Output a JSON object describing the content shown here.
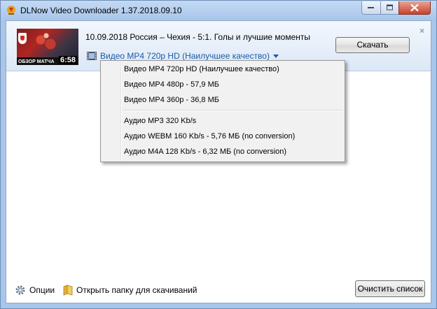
{
  "window": {
    "title": "DLNow Video Downloader 1.37.2018.09.10",
    "controls": {
      "minimize": "minimize",
      "maximize": "maximize",
      "close": "close"
    }
  },
  "item": {
    "thumbnail": {
      "caption": "ОБЗОР МАТЧА",
      "duration": "6:58"
    },
    "title": "10.09.2018 Россия – Чехия - 5:1. Голы и лучшие моменты",
    "selected_format": "Видео MP4 720p HD (Наилучшее качество)",
    "download_label": "Скачать",
    "close_glyph": "×"
  },
  "format_menu": {
    "video_options": [
      "Видео MP4 720p HD (Наилучшее качество)",
      "Видео MP4 480p - 57,9 МБ",
      "Видео MP4 360p - 36,8 МБ"
    ],
    "audio_options": [
      "Аудио MP3 320 Kb/s",
      "Аудио WEBM 160 Kb/s - 5,76 МБ (no conversion)",
      "Аудио M4A 128 Kb/s - 6,32 МБ (no conversion)"
    ]
  },
  "footer": {
    "options_label": "Опции",
    "open_folder_label": "Открыть папку для скачиваний",
    "clear_list_label": "Очистить список"
  },
  "colors": {
    "link_blue": "#1a5ba8",
    "titlebar": "#a8c5e9",
    "close_red": "#c7432c"
  }
}
